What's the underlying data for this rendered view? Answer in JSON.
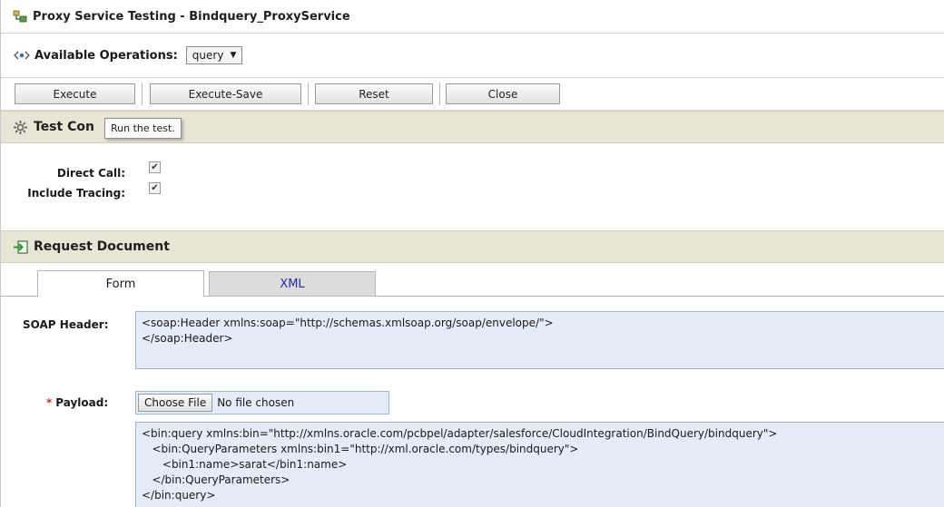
{
  "window": {
    "title": "Proxy Service Testing - Bindquery_ProxyService"
  },
  "operations": {
    "label": "Available Operations:",
    "selected": "query"
  },
  "toolbar": {
    "execute_label": "Execute",
    "execute_save_label": "Execute-Save",
    "reset_label": "Reset",
    "close_label": "Close"
  },
  "tooltip": {
    "text": "Run the test."
  },
  "test_config": {
    "title": "Test Con",
    "direct_call_label": "Direct Call:",
    "direct_call_checked": true,
    "include_tracing_label": "Include Tracing:",
    "include_tracing_checked": true
  },
  "request": {
    "title": "Request Document",
    "tabs": [
      {
        "label": "Form",
        "active": true
      },
      {
        "label": "XML",
        "active": false
      }
    ],
    "soap_header_label": "SOAP Header:",
    "soap_header_lines": [
      "<soap:Header xmlns:soap=\"http://schemas.xmlsoap.org/soap/envelope/\">",
      "</soap:Header>"
    ],
    "payload_label": "Payload:",
    "required_mark": "*",
    "choose_file_label": "Choose File",
    "no_file_text": "No file chosen",
    "payload_lines": [
      "<bin:query xmlns:bin=\"http://xmlns.oracle.com/pcbpel/adapter/salesforce/CloudIntegration/BindQuery/bindquery\">",
      "   <bin:QueryParameters xmlns:bin1=\"http://xml.oracle.com/types/bindquery\">",
      "      <bin1:name>sarat</bin1:name>",
      "   </bin:QueryParameters>",
      "</bin:query>"
    ]
  },
  "colors": {
    "section_bar": "#e9e5d6",
    "textarea_bg": "#e4ecf7",
    "xml_tab_text": "#2a2aa8",
    "required_star": "#c0392b"
  }
}
